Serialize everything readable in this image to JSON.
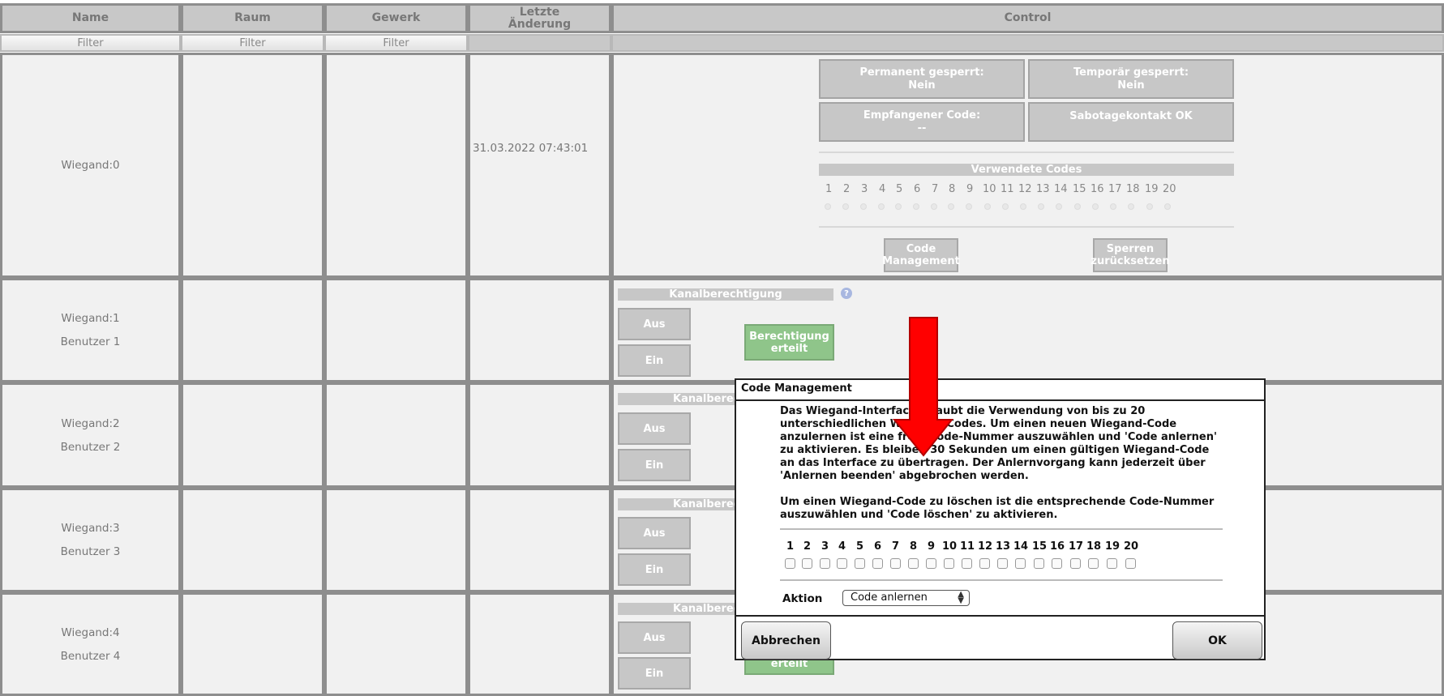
{
  "table": {
    "headers": {
      "name": "Name",
      "raum": "Raum",
      "gewerk": "Gewerk",
      "letzte": "Letzte\nÄnderung",
      "control": "Control"
    },
    "filter_label": "Filter"
  },
  "row0": {
    "name": "Wiegand:0",
    "date": "31.03.2022 07:43:01",
    "perm_locked": "Permanent gesperrt:\nNein",
    "temp_locked": "Temporär gesperrt:\nNein",
    "received_code": "Empfangener Code:\n--",
    "sabotage": "Sabotagekontakt OK",
    "used_codes": "Verwendete Codes",
    "code_numbers": [
      "1",
      "2",
      "3",
      "4",
      "5",
      "6",
      "7",
      "8",
      "9",
      "10",
      "11",
      "12",
      "13",
      "14",
      "15",
      "16",
      "17",
      "18",
      "19",
      "20"
    ],
    "code_mgmt_btn": "Code\nManagement",
    "reset_btn": "Sperren\nzurücksetzen"
  },
  "rows": [
    {
      "name": "Wiegand:1",
      "user": "Benutzer 1"
    },
    {
      "name": "Wiegand:2",
      "user": "Benutzer 2"
    },
    {
      "name": "Wiegand:3",
      "user": "Benutzer 3"
    },
    {
      "name": "Wiegand:4",
      "user": "Benutzer 4"
    }
  ],
  "channel": {
    "title": "Kanalberechtigung",
    "title_short": "Kanalberec",
    "off": "Aus",
    "on": "Ein",
    "granted": "Berechtigung\nerteilt",
    "granted_partial": "erteilt"
  },
  "dialog": {
    "title": "Code Management",
    "text": "Das Wiegand-Interface erlaubt die Verwendung von bis zu 20\nunterschiedlichen Wiegand-Codes. Um einen neuen Wiegand-Code\nanzulernen ist eine freie Code-Nummer auszuwählen und 'Code anlernen'\nzu aktivieren. Es bleiben 30 Sekunden um einen gültigen Wiegand-Code\nan das Interface zu übertragen. Der Anlernvorgang kann jederzeit über\n'Anlernen beenden' abgebrochen werden.\n\nUm einen Wiegand-Code zu löschen ist die entsprechende Code-Nummer\nauszuwählen und 'Code löschen' zu aktivieren.",
    "code_numbers": [
      "1",
      "2",
      "3",
      "4",
      "5",
      "6",
      "7",
      "8",
      "9",
      "10",
      "11",
      "12",
      "13",
      "14",
      "15",
      "16",
      "17",
      "18",
      "19",
      "20"
    ],
    "action_label": "Aktion",
    "action_value": "Code anlernen",
    "cancel": "Abbrechen",
    "ok": "OK"
  },
  "colors": {
    "arrow": "#ff0000",
    "granted": "#8fc58a"
  },
  "icons": {
    "help": "help-icon",
    "arrow": "red-arrow-down"
  }
}
